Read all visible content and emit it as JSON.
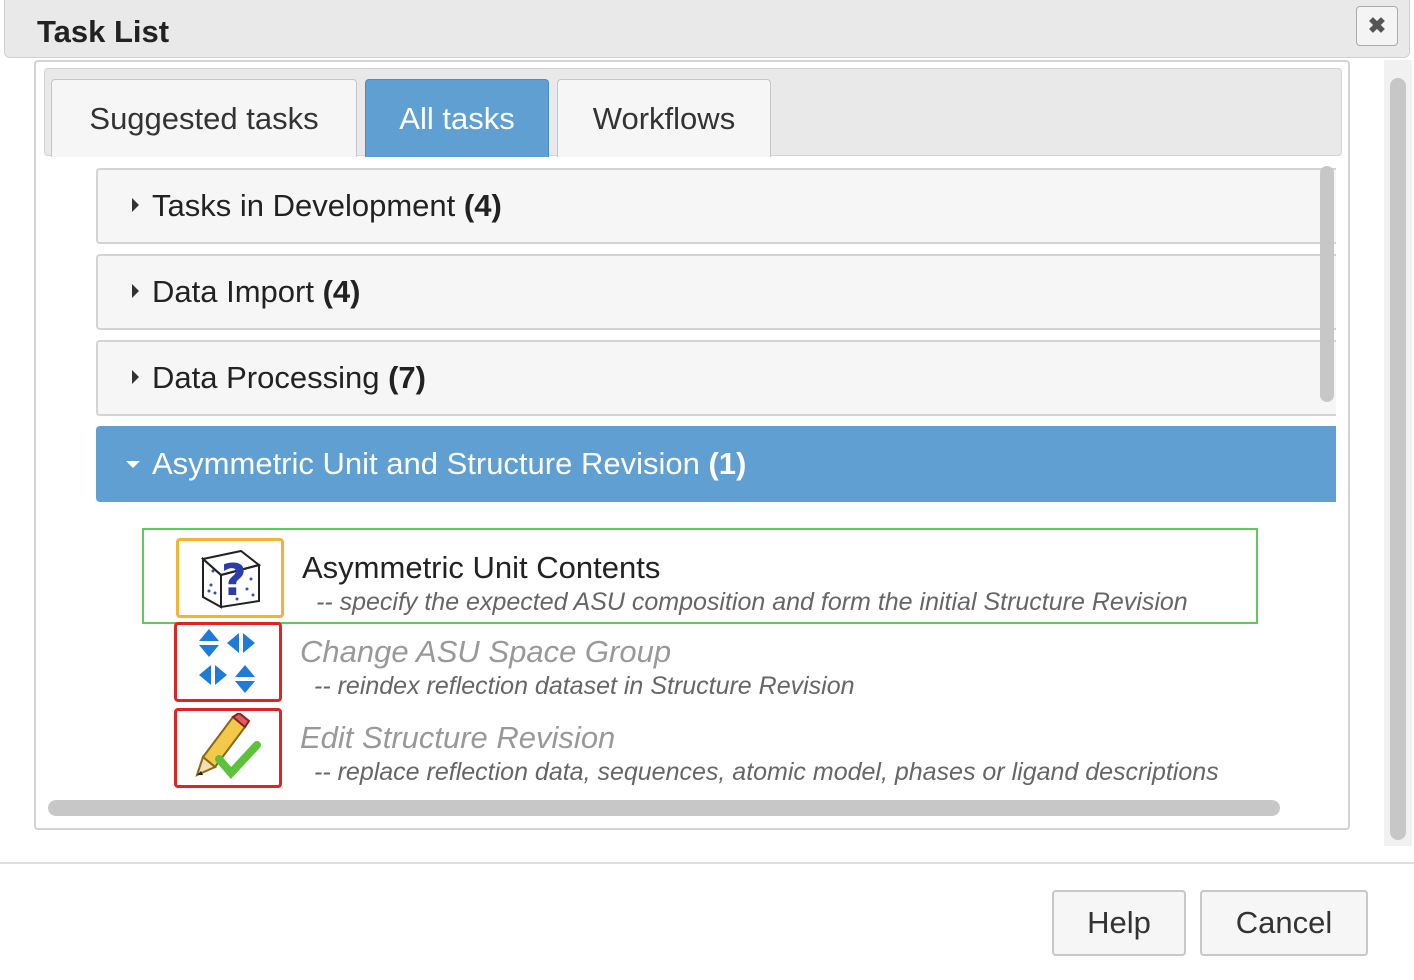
{
  "window": {
    "title": "Task List",
    "close_label": "✖"
  },
  "tabs": [
    {
      "label": "Suggested tasks",
      "active": false
    },
    {
      "label": "All tasks",
      "active": true
    },
    {
      "label": "Workflows",
      "active": false
    }
  ],
  "sections": [
    {
      "label": "Tasks in Development",
      "count": "(4)",
      "expanded": false
    },
    {
      "label": "Data Import",
      "count": "(4)",
      "expanded": false
    },
    {
      "label": "Data Processing",
      "count": "(7)",
      "expanded": false
    },
    {
      "label": "Asymmetric Unit and Structure Revision",
      "count": "(1)",
      "expanded": true
    }
  ],
  "tasks": [
    {
      "title": "Asymmetric Unit Contents",
      "description": "-- specify the expected ASU composition and form the initial Structure Revision",
      "icon": "asu-question-cube-icon",
      "enabled": true
    },
    {
      "title": "Change ASU Space Group",
      "description": "-- reindex reflection dataset in Structure Revision",
      "icon": "space-group-arrows-icon",
      "enabled": false
    },
    {
      "title": "Edit Structure Revision",
      "description": "-- replace reflection data, sequences, atomic model, phases or ligand descriptions",
      "icon": "pencil-check-icon",
      "enabled": false
    }
  ],
  "footer": {
    "help_label": "Help",
    "cancel_label": "Cancel"
  },
  "colors": {
    "accent": "#5f9fd1",
    "selected_border": "#5fc95f",
    "ok_icon_border": "#f5b233",
    "bad_icon_border": "#e02424"
  }
}
